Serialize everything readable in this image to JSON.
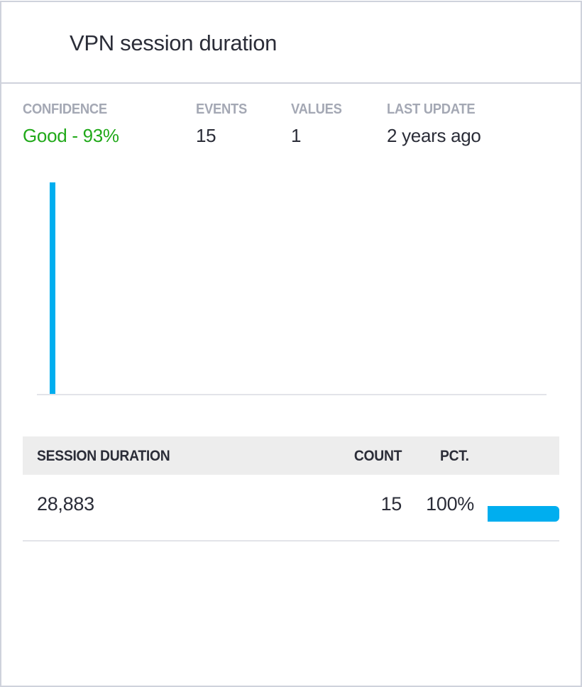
{
  "card": {
    "title": "VPN session duration"
  },
  "stats": [
    {
      "label": "CONFIDENCE",
      "value": "Good - 93%",
      "status": "good",
      "status_color": "#21a91a"
    },
    {
      "label": "EVENTS",
      "value": "15"
    },
    {
      "label": "VALUES",
      "value": "1"
    },
    {
      "label": "LAST UPDATE",
      "value": "2 years ago"
    }
  ],
  "chart_data": {
    "type": "bar",
    "title": "",
    "xlabel": "",
    "ylabel": "",
    "categories": [
      "28,883"
    ],
    "values": [
      15
    ],
    "ylim": [
      0,
      15
    ],
    "grid": false,
    "color": "#00aeef"
  },
  "table": {
    "columns": [
      "SESSION DURATION",
      "COUNT",
      "PCT."
    ],
    "rows": [
      {
        "value": "28,883",
        "count": "15",
        "pct": "100%",
        "pct_fraction": 1.0
      }
    ],
    "bar_color": "#00aeef"
  }
}
